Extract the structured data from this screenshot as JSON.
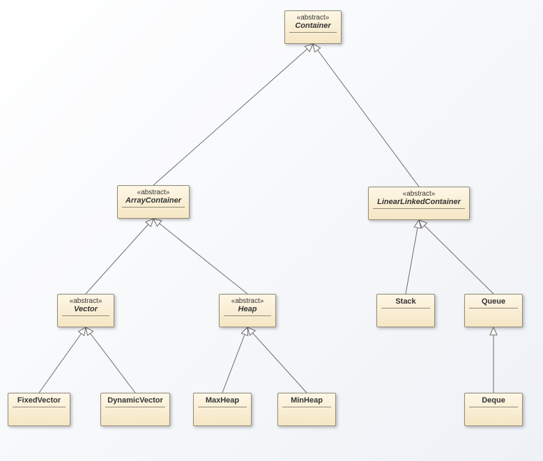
{
  "stereotype_abstract": "«abstract»",
  "nodes": {
    "container": {
      "label": "Container",
      "abstract": true
    },
    "arrayContainer": {
      "label": "ArrayContainer",
      "abstract": true
    },
    "linearLinkedContainer": {
      "label": "LinearLinkedContainer",
      "abstract": true
    },
    "vector": {
      "label": "Vector",
      "abstract": true
    },
    "heap": {
      "label": "Heap",
      "abstract": true
    },
    "stack": {
      "label": "Stack",
      "abstract": false
    },
    "queue": {
      "label": "Queue",
      "abstract": false
    },
    "fixedVector": {
      "label": "FixedVector",
      "abstract": false
    },
    "dynamicVector": {
      "label": "DynamicVector",
      "abstract": false
    },
    "maxHeap": {
      "label": "MaxHeap",
      "abstract": false
    },
    "minHeap": {
      "label": "MinHeap",
      "abstract": false
    },
    "deque": {
      "label": "Deque",
      "abstract": false
    }
  },
  "edges": [
    {
      "from": "arrayContainer",
      "to": "container"
    },
    {
      "from": "linearLinkedContainer",
      "to": "container"
    },
    {
      "from": "vector",
      "to": "arrayContainer"
    },
    {
      "from": "heap",
      "to": "arrayContainer"
    },
    {
      "from": "stack",
      "to": "linearLinkedContainer"
    },
    {
      "from": "queue",
      "to": "linearLinkedContainer"
    },
    {
      "from": "fixedVector",
      "to": "vector"
    },
    {
      "from": "dynamicVector",
      "to": "vector"
    },
    {
      "from": "maxHeap",
      "to": "heap"
    },
    {
      "from": "minHeap",
      "to": "heap"
    },
    {
      "from": "deque",
      "to": "queue"
    }
  ]
}
